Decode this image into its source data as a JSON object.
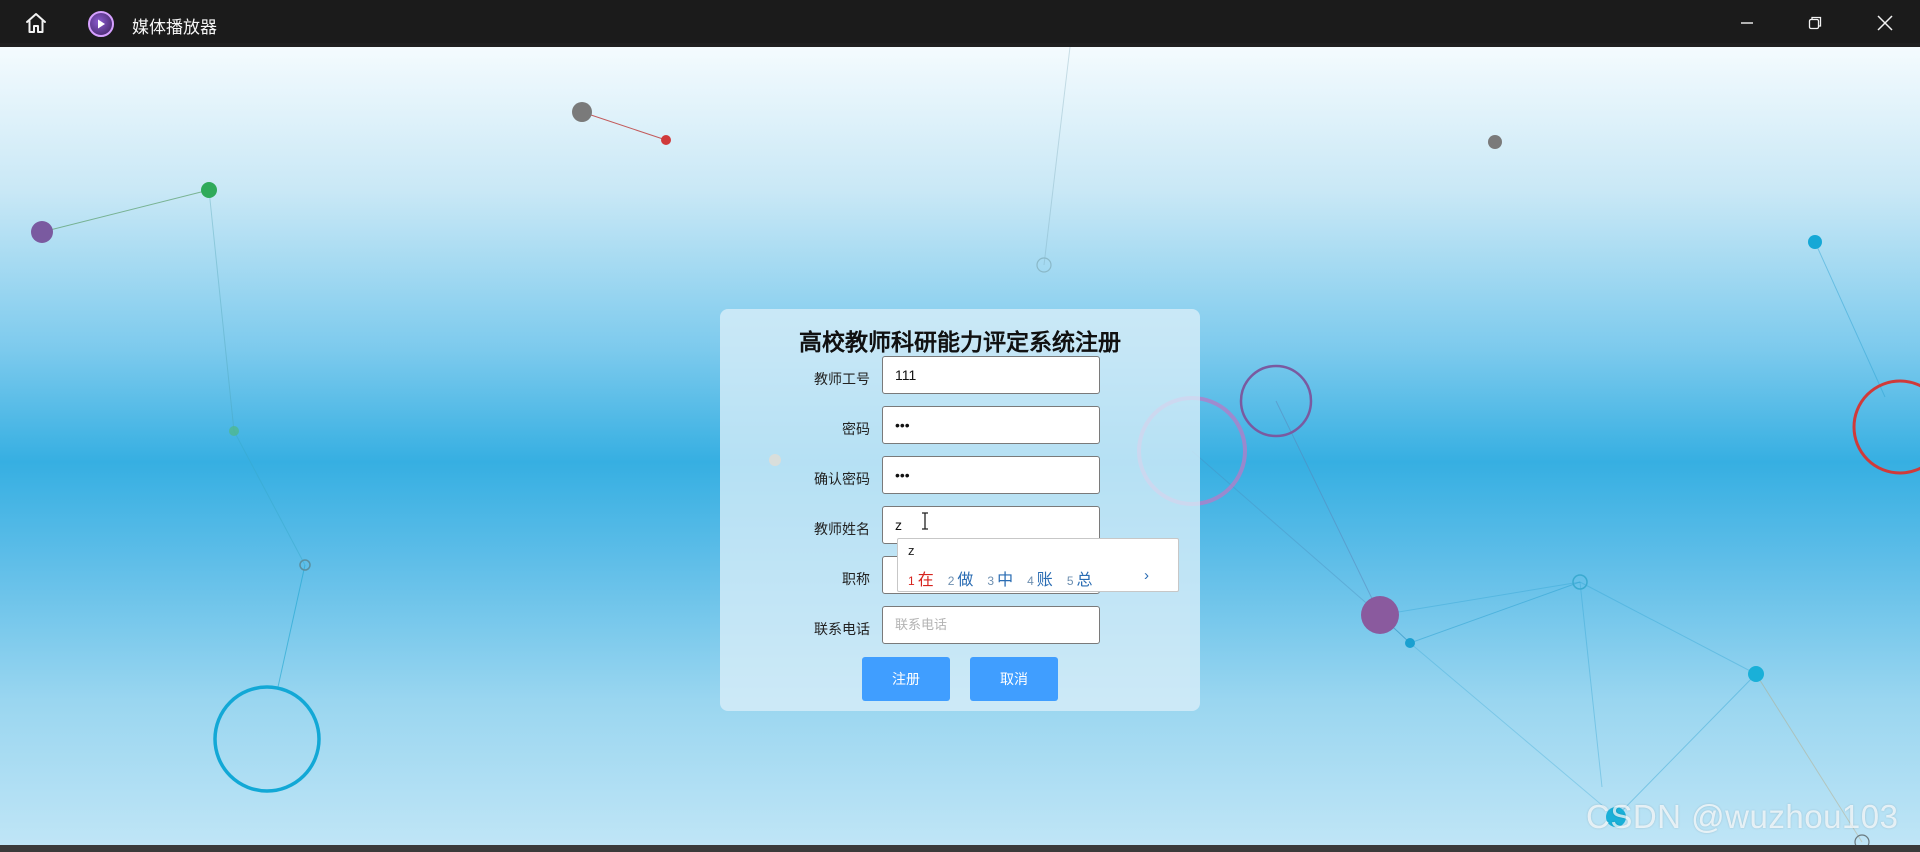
{
  "app": {
    "title": "媒体播放器"
  },
  "form": {
    "title": "高校教师科研能力评定系统注册",
    "fields": [
      {
        "label": "教师工号",
        "value": "111",
        "placeholder": ""
      },
      {
        "label": "密码",
        "value": "•••",
        "placeholder": ""
      },
      {
        "label": "确认密码",
        "value": "•••",
        "placeholder": ""
      },
      {
        "label": "教师姓名",
        "value": "z",
        "placeholder": ""
      },
      {
        "label": "职称",
        "value": "",
        "placeholder": ""
      },
      {
        "label": "联系电话",
        "value": "",
        "placeholder": "联系电话"
      }
    ],
    "register_label": "注册",
    "cancel_label": "取消"
  },
  "ime": {
    "composition": "z",
    "candidates": [
      {
        "num": "1",
        "char": "在"
      },
      {
        "num": "2",
        "char": "做"
      },
      {
        "num": "3",
        "char": "中"
      },
      {
        "num": "4",
        "char": "账"
      },
      {
        "num": "5",
        "char": "总"
      }
    ],
    "next_glyph": "›"
  },
  "watermark": "CSDN @wuzhou103",
  "icons": {
    "home": "home-icon",
    "app": "play-icon",
    "minimize": "minimize-icon",
    "maximize": "restore-icon",
    "close": "close-icon"
  },
  "colors": {
    "accent": "#409eff",
    "titlebar": "#1b1b1b",
    "candidate_selected": "#d6231e"
  }
}
